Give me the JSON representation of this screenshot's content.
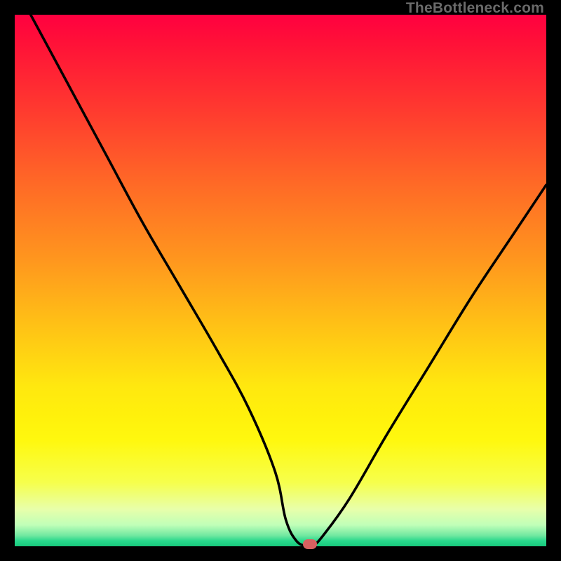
{
  "watermark": "TheBottleneck.com",
  "colors": {
    "frame": "#000000",
    "curve_stroke": "#000000",
    "marker_fill": "#d86060",
    "gradient_top": "#ff0040",
    "gradient_bottom": "#18c87c"
  },
  "chart_data": {
    "type": "line",
    "title": "",
    "xlabel": "",
    "ylabel": "",
    "xlim": [
      0,
      100
    ],
    "ylim": [
      0,
      100
    ],
    "grid": false,
    "legend": false,
    "series": [
      {
        "name": "bottleneck-curve",
        "x": [
          3,
          10,
          17,
          24,
          31,
          38,
          44,
          49,
          51,
          53,
          55,
          56,
          58,
          63,
          70,
          78,
          86,
          94,
          100
        ],
        "values": [
          100,
          87,
          74,
          61,
          49,
          37,
          26,
          14,
          5,
          1,
          0,
          0,
          2,
          9,
          21,
          34,
          47,
          59,
          68
        ]
      }
    ],
    "marker": {
      "x": 55.5,
      "y": 0,
      "shape": "pill",
      "color": "#d86060"
    },
    "annotations": []
  }
}
